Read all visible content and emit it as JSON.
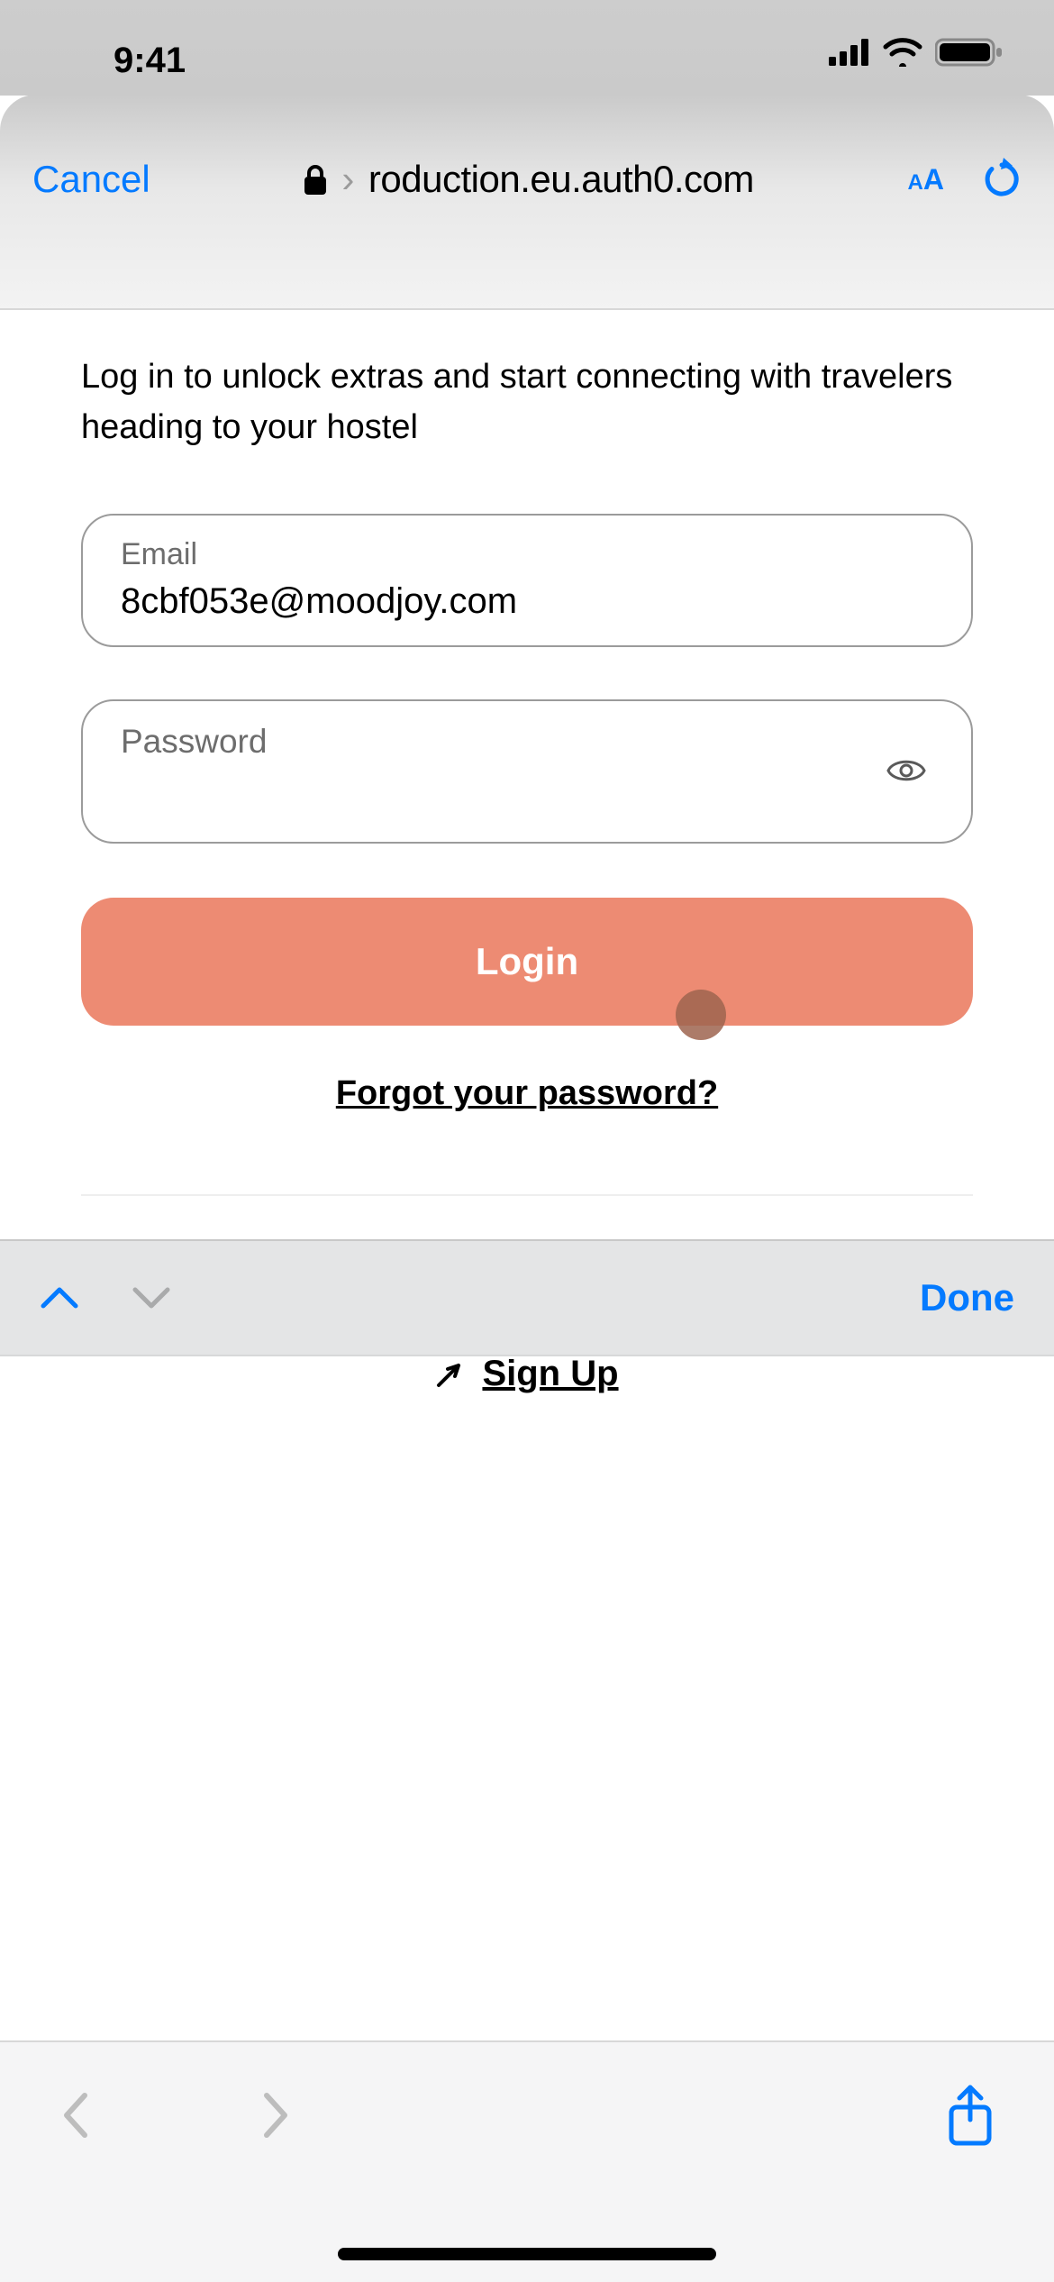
{
  "statusbar": {
    "time": "9:41"
  },
  "chrome": {
    "cancel_label": "Cancel",
    "url": "roduction.eu.auth0.com",
    "text_size_label": "A",
    "text_size_label_big": "A"
  },
  "page": {
    "intro": "Log in to unlock extras and start connecting with travelers heading to your hostel",
    "email_label": "Email",
    "email_value": "8cbf053e@moodjoy.com",
    "password_label": "Password",
    "login_label": "Login",
    "forgot_label": "Forgot your password?",
    "signup_label": "Sign Up"
  },
  "kbaccessory": {
    "done_label": "Done"
  }
}
